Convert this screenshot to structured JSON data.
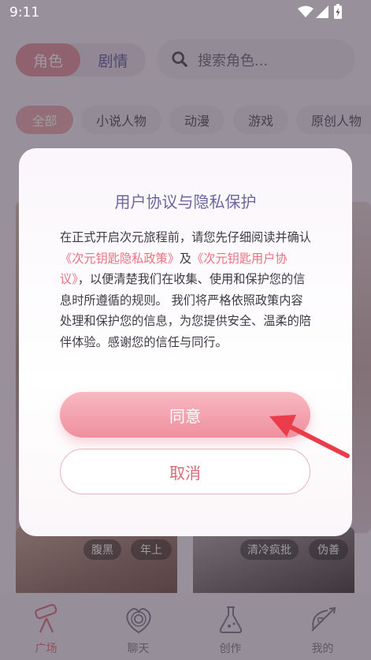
{
  "status_bar": {
    "time": "9:11"
  },
  "top": {
    "segments": [
      "角色",
      "剧情"
    ],
    "search_placeholder": "搜索角色..."
  },
  "categories": [
    "全部",
    "小说人物",
    "动漫",
    "游戏",
    "原创人物"
  ],
  "cards": [
    {
      "tags": [
        "腹黑",
        "年上"
      ]
    },
    {
      "tags": [
        "清冷疯批",
        "伪善"
      ]
    }
  ],
  "tabs": [
    "广场",
    "聊天",
    "创作",
    "我的"
  ],
  "dialog": {
    "title": "用户协议与隐私保护",
    "body_1": "在正式开启次元旅程前，请您先仔细阅读并确认",
    "link_privacy": "《次元钥匙隐私政策》",
    "body_2": "及",
    "link_terms": "《次元钥匙用户协议》",
    "body_3": "，以便清楚我们在收集、使用和保护您的信息时所遵循的规则。 我们将严格依照政策内容处理和保护您的信息，为您提供安全、温柔的陪伴体验。感谢您的信任与同行。",
    "agree_label": "同意",
    "cancel_label": "取消"
  },
  "colors": {
    "accent_pink": "#f08f9e",
    "link_pink": "#e9727f",
    "title_purple": "#6c66a0",
    "annotation_red": "#ea3c4a"
  }
}
